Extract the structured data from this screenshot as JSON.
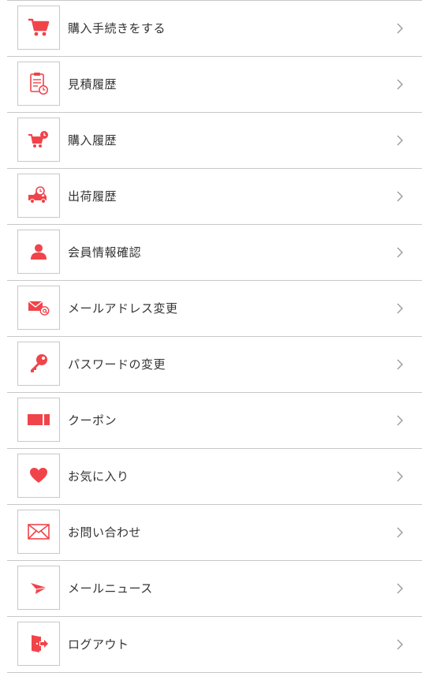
{
  "colors": {
    "accent": "#f0444a",
    "border": "#c8c8c8",
    "text": "#333333",
    "chevron": "#9a9a9a"
  },
  "menu": {
    "items": [
      {
        "label": "購入手続きをする",
        "icon": "cart-icon"
      },
      {
        "label": "見積履歴",
        "icon": "estimate-clipboard-icon"
      },
      {
        "label": "購入履歴",
        "icon": "cart-clock-icon"
      },
      {
        "label": "出荷履歴",
        "icon": "truck-clock-icon"
      },
      {
        "label": "会員情報確認",
        "icon": "user-icon"
      },
      {
        "label": "メールアドレス変更",
        "icon": "mail-at-icon"
      },
      {
        "label": "パスワードの変更",
        "icon": "key-icon"
      },
      {
        "label": "クーポン",
        "icon": "coupon-icon"
      },
      {
        "label": "お気に入り",
        "icon": "heart-icon"
      },
      {
        "label": "お問い合わせ",
        "icon": "envelope-icon"
      },
      {
        "label": "メールニュース",
        "icon": "paper-plane-icon"
      },
      {
        "label": "ログアウト",
        "icon": "logout-door-icon"
      }
    ]
  }
}
